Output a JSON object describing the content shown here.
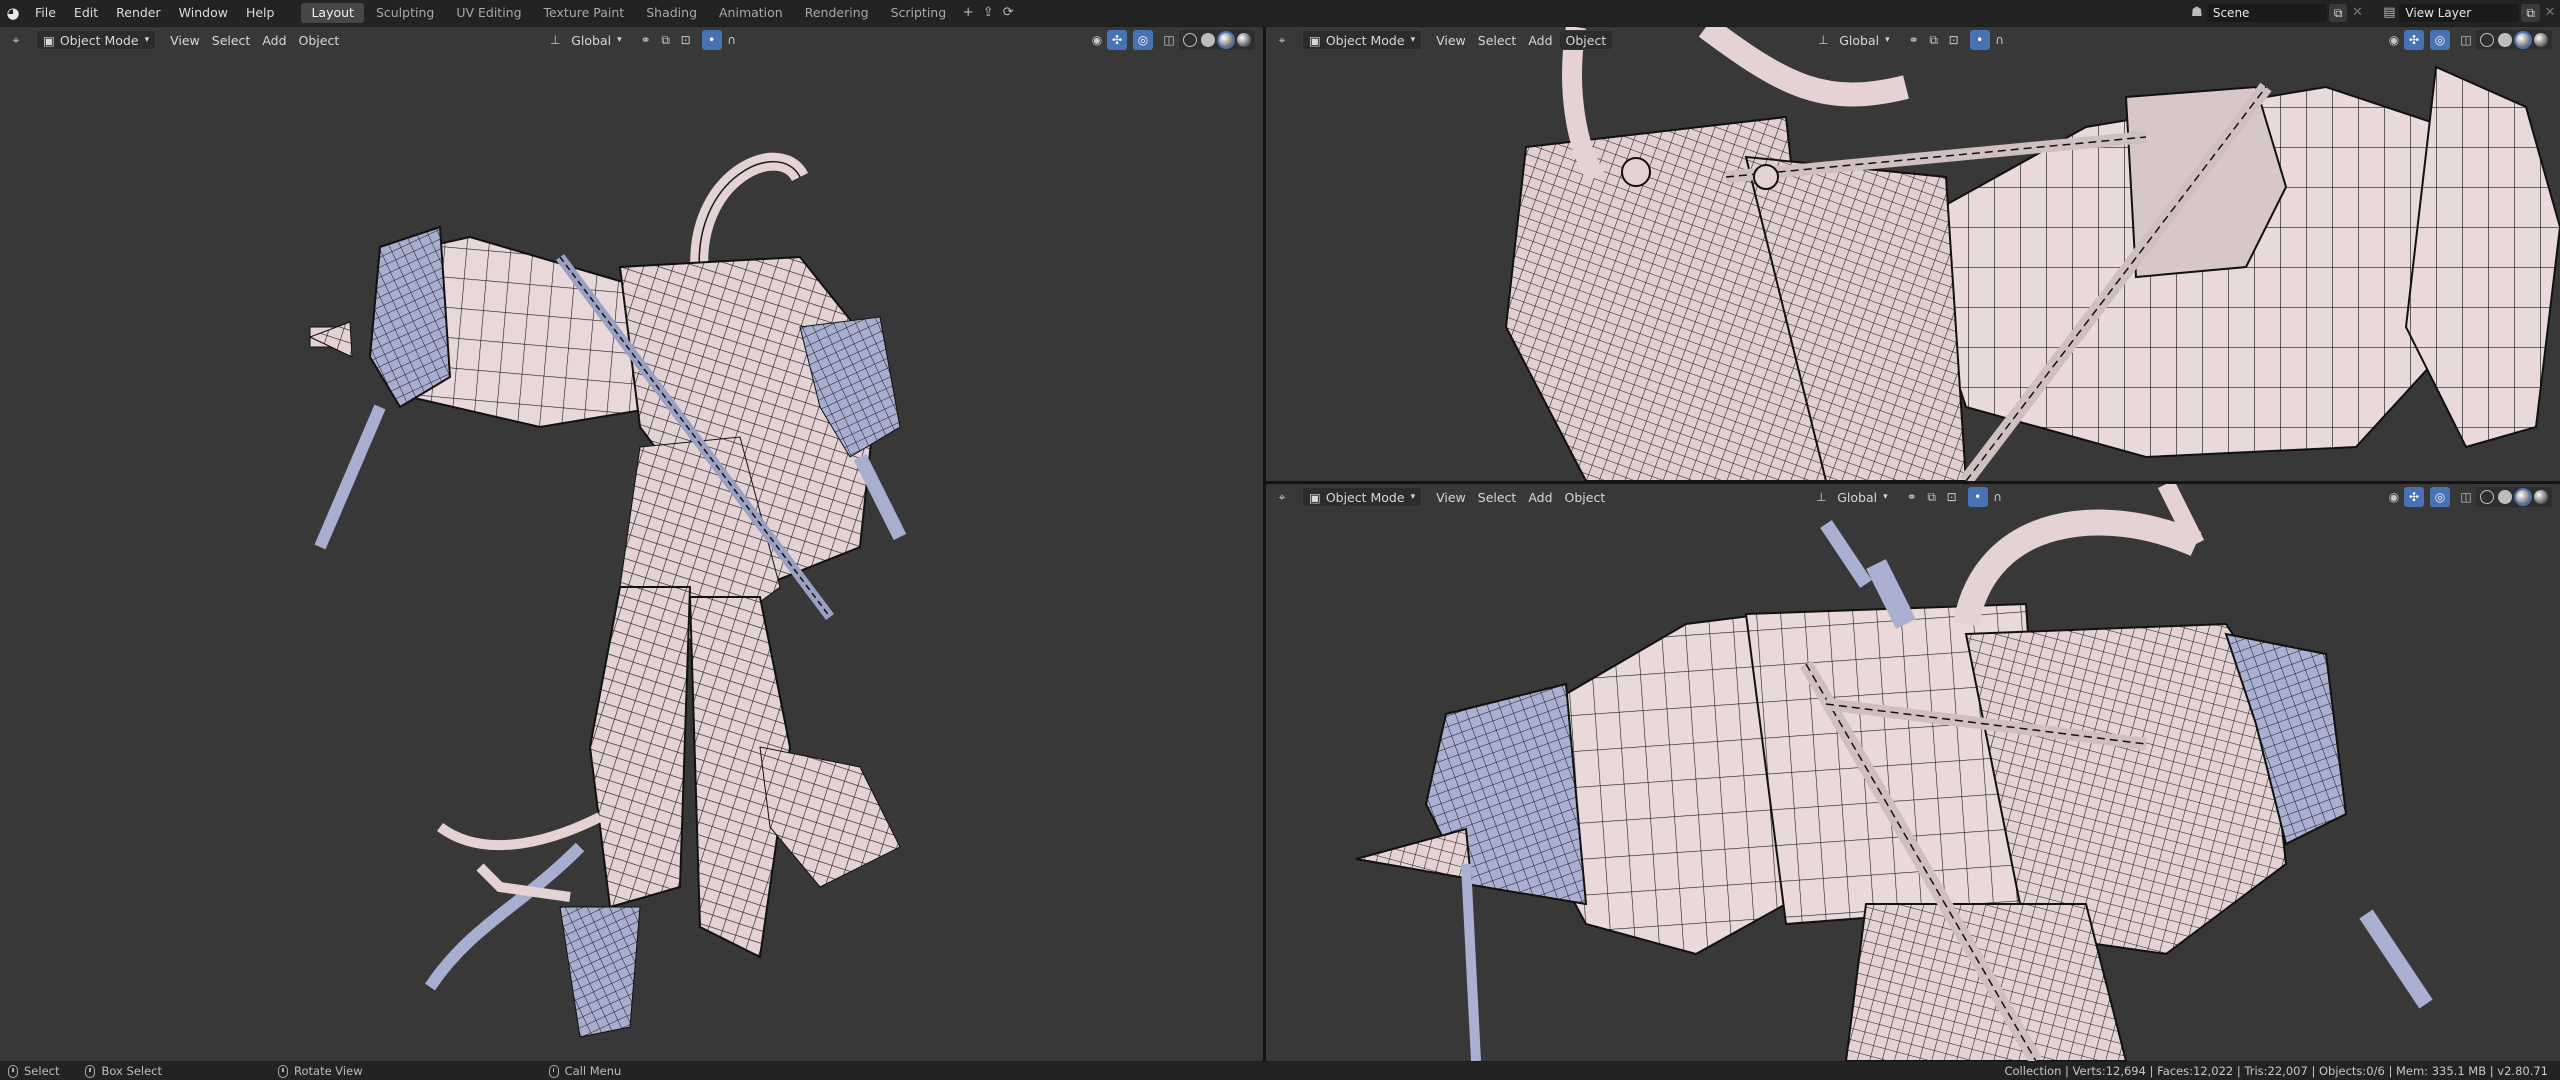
{
  "topbar": {
    "menus": [
      "File",
      "Edit",
      "Render",
      "Window",
      "Help"
    ],
    "workspaces": [
      "Layout",
      "Sculpting",
      "UV Editing",
      "Texture Paint",
      "Shading",
      "Animation",
      "Rendering",
      "Scripting"
    ],
    "active_workspace": "Layout",
    "scene_name": "Scene",
    "view_layer_name": "View Layer"
  },
  "viewport_header": {
    "mode": "Object Mode",
    "menus": [
      "View",
      "Select",
      "Add",
      "Object"
    ],
    "transform_orientation": "Global"
  },
  "statusbar": {
    "select": "Select",
    "box_select": "Box Select",
    "rotate_view": "Rotate View",
    "call_menu": "Call Menu",
    "stats": "Collection | Verts:12,694 | Faces:12,022 | Tris:22,007 | Objects:0/6 | Mem: 335.1 MB | v2.80.71"
  },
  "colors": {
    "accent": "#4772b3",
    "viewport_bg": "#393939",
    "mesh_light": "#e6d5d6",
    "mesh_shadow": "#9fa5c8",
    "wire": "#1e1e1e"
  },
  "icons": {
    "logo": "blender-logo-icon",
    "editor_type": "3d-viewport-icon",
    "mode": "object-mode-icon",
    "pivot": "pivot-icon",
    "snap": "snap-icon",
    "proportional": "proportional-edit-icon",
    "visibility": "visibility-icon",
    "gizmo": "gizmo-icon",
    "overlay": "overlay-icon",
    "xray": "xray-icon"
  }
}
